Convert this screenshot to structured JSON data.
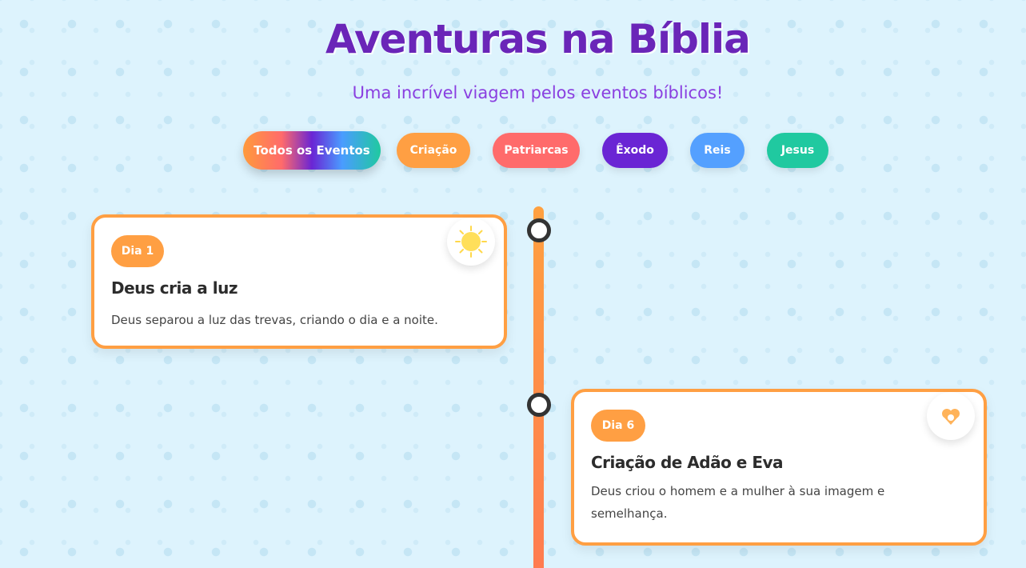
{
  "header": {
    "title": "Aventuras na Bíblia",
    "subtitle": "Uma incrível viagem pelos eventos bíblicos!"
  },
  "filters": [
    {
      "label": "Todos os Eventos",
      "active": true
    },
    {
      "label": "Criação",
      "color": "#ff9f43"
    },
    {
      "label": "Patriarcas",
      "color": "#ff6b6b"
    },
    {
      "label": "Êxodo",
      "color": "#6a25d4"
    },
    {
      "label": "Reis",
      "color": "#54a0ff"
    },
    {
      "label": "Jesus",
      "color": "#20c9a0"
    }
  ],
  "events": [
    {
      "badge": "Dia 1",
      "title": "Deus cria a luz",
      "description": "Deus separou a luz das trevas, criando o dia e a noite.",
      "icon": "sun-icon"
    },
    {
      "badge": "Dia 6",
      "title": "Criação de Adão e Eva",
      "description": "Deus criou o homem e a mulher à sua imagem e semelhança.",
      "icon": "hearts-icon"
    }
  ],
  "colors": {
    "accent": "#ff9f43",
    "title": "#6a25b8",
    "subtitle": "#8a3fe0"
  }
}
